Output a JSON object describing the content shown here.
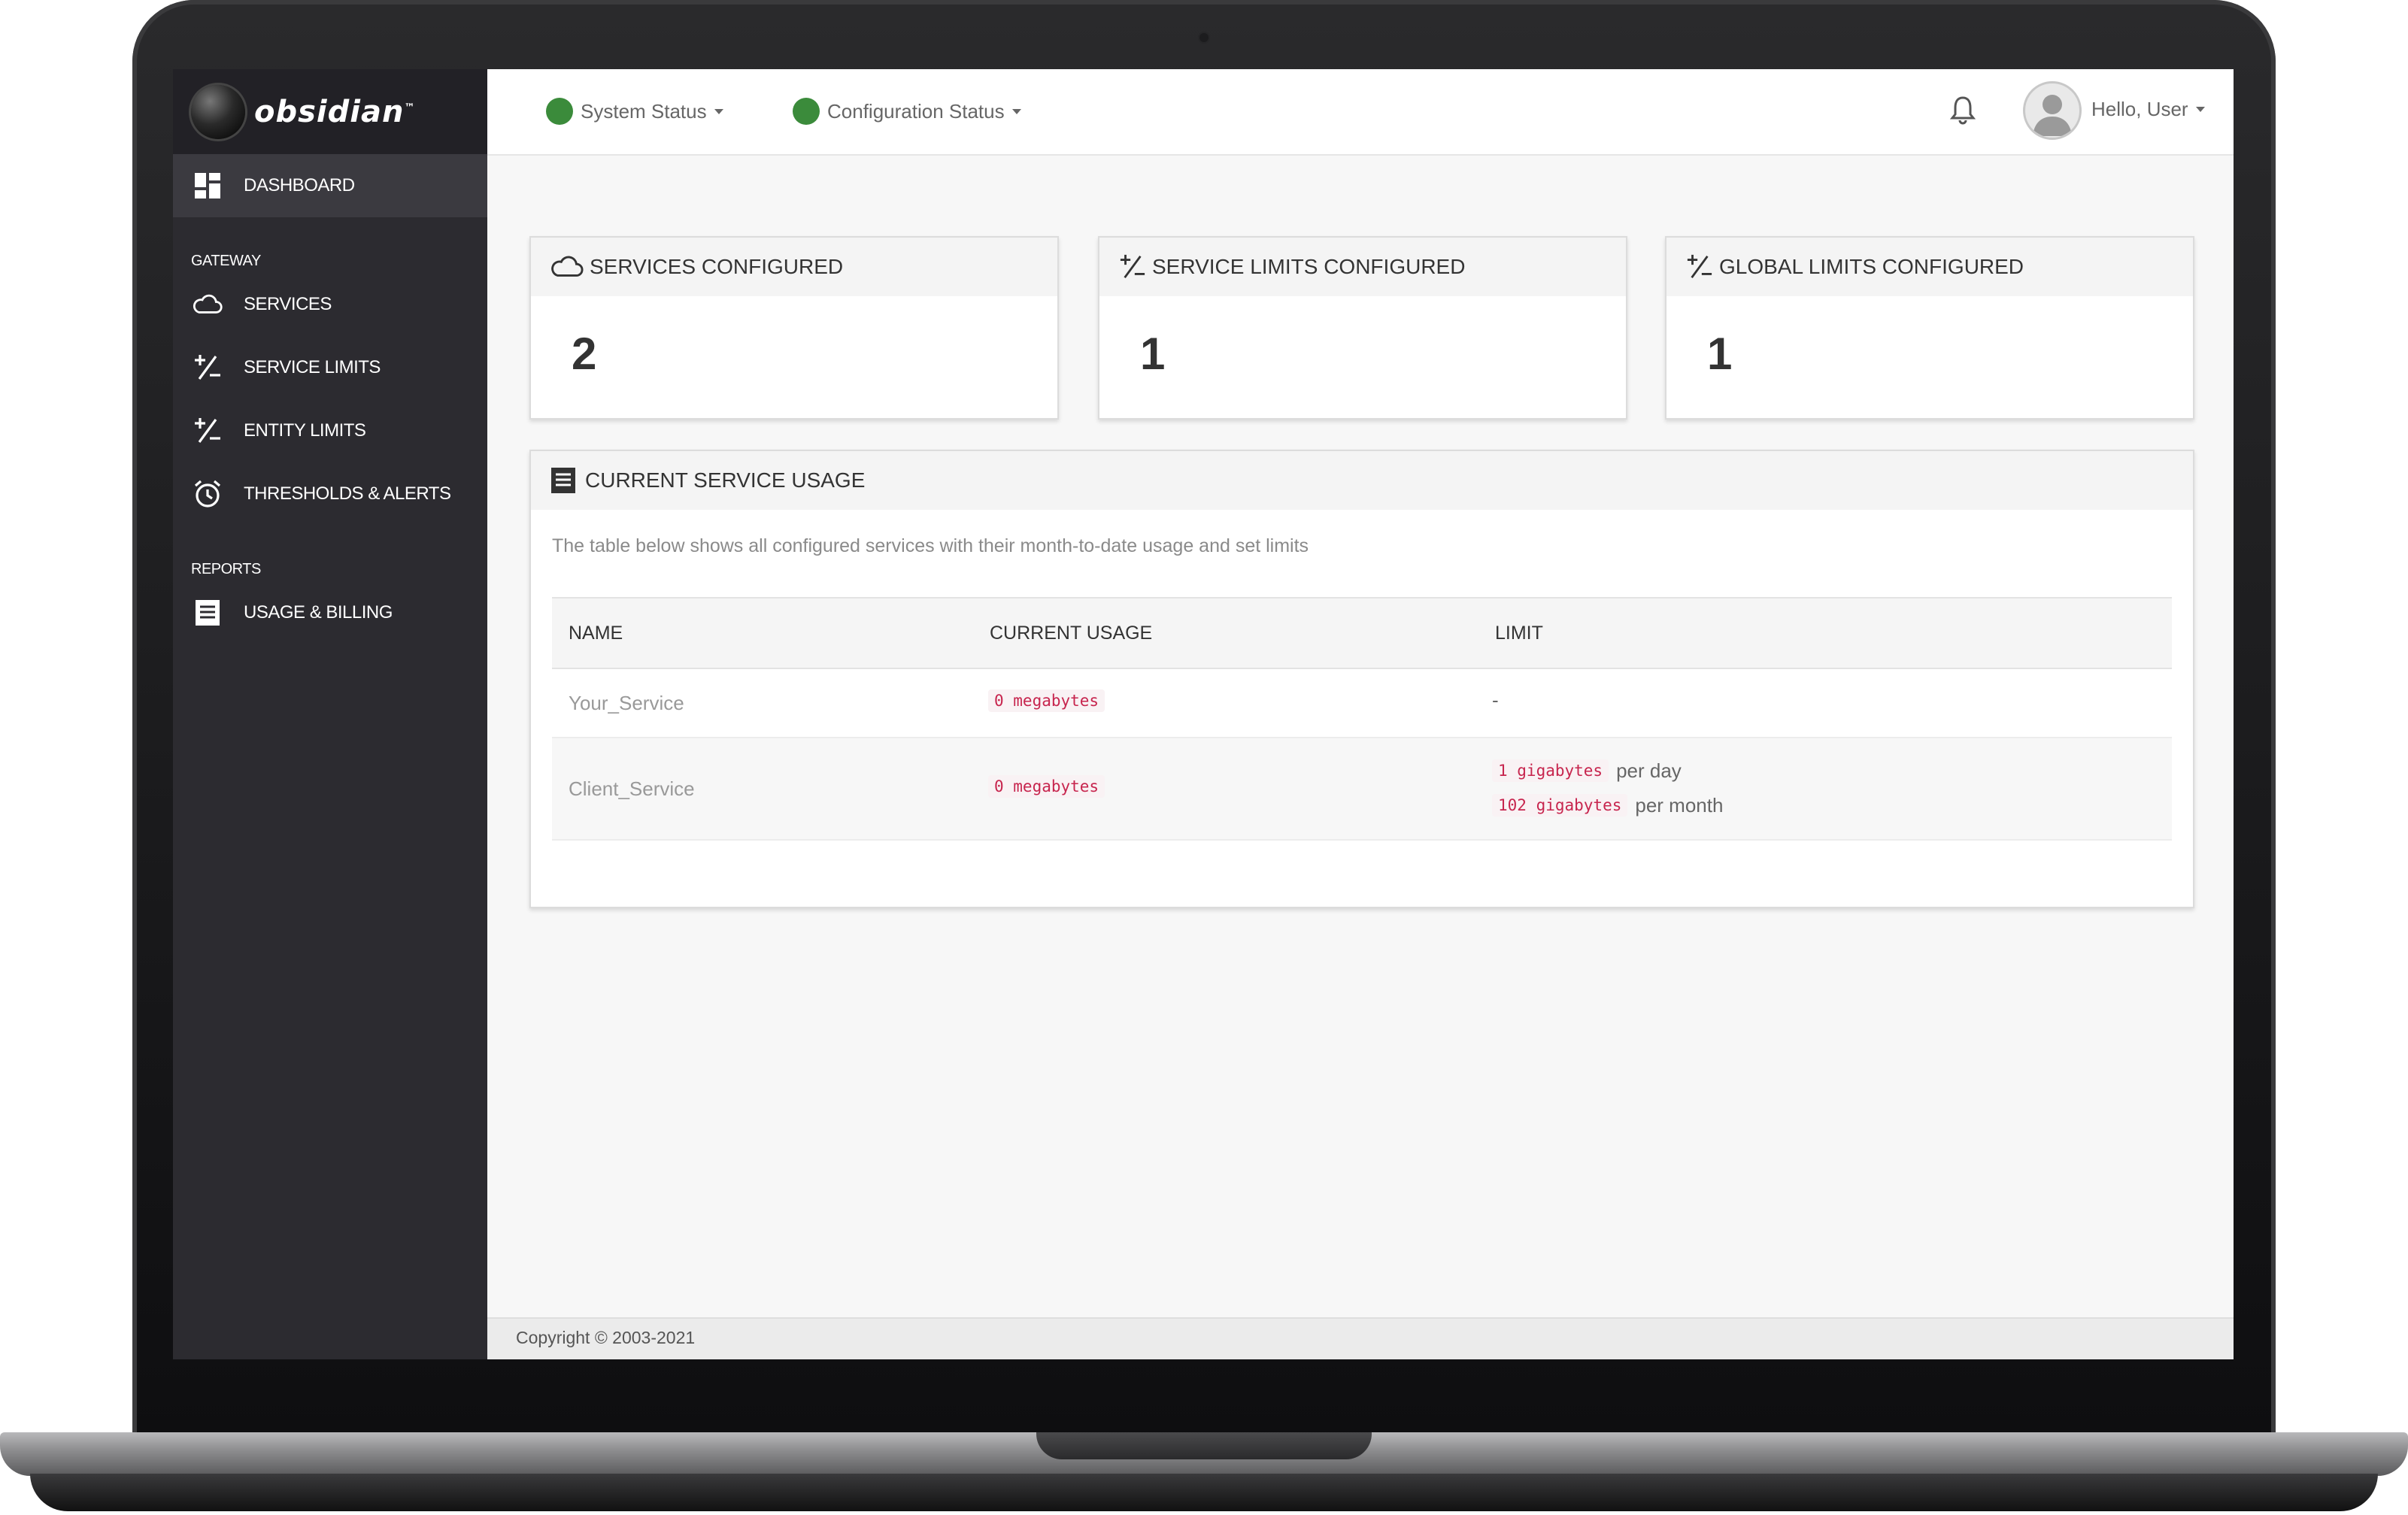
{
  "app": {
    "logo_text": "obsidian",
    "logo_mark": "™"
  },
  "sidebar": {
    "dashboard_label": "DASHBOARD",
    "gateway_section": "GATEWAY",
    "gateway_items": [
      {
        "label": "SERVICES",
        "icon": "cloud-icon"
      },
      {
        "label": "SERVICE LIMITS",
        "icon": "plus-minus-icon"
      },
      {
        "label": "ENTITY LIMITS",
        "icon": "plus-minus-icon"
      },
      {
        "label": "THRESHOLDS & ALERTS",
        "icon": "alarm-clock-icon"
      }
    ],
    "reports_section": "REPORTS",
    "reports_items": [
      {
        "label": "USAGE & BILLING",
        "icon": "list-icon"
      }
    ]
  },
  "topbar": {
    "system_status": "System Status",
    "configuration_status": "Configuration Status",
    "status_color": "#3b8b3b",
    "greeting": "Hello, User"
  },
  "cards": [
    {
      "title": "SERVICES CONFIGURED",
      "value": "2",
      "icon": "cloud-icon"
    },
    {
      "title": "SERVICE LIMITS CONFIGURED",
      "value": "1",
      "icon": "plus-minus-icon"
    },
    {
      "title": "GLOBAL LIMITS CONFIGURED",
      "value": "1",
      "icon": "plus-minus-icon"
    }
  ],
  "usage": {
    "title": "CURRENT SERVICE USAGE",
    "description": "The table below shows all configured services with their month-to-date usage and set limits",
    "columns": [
      "NAME",
      "CURRENT USAGE",
      "LIMIT"
    ],
    "rows": [
      {
        "name": "Your_Service",
        "usage": "0 megabytes",
        "limit": "-"
      },
      {
        "name": "Client_Service",
        "usage": "0 megabytes",
        "limits": [
          {
            "value": "1 gigabytes",
            "period": "per day"
          },
          {
            "value": "102 gigabytes",
            "period": "per month"
          }
        ]
      }
    ]
  },
  "footer": {
    "copyright": "Copyright © 2003-2021"
  }
}
